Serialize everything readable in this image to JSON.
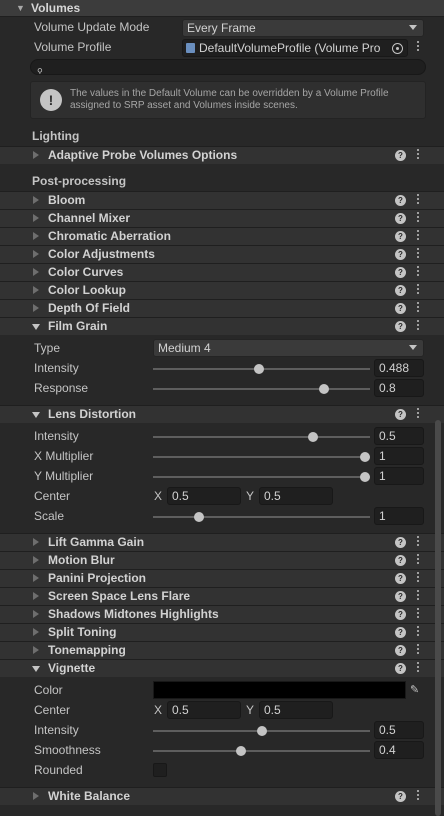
{
  "panel": {
    "title": "Volumes"
  },
  "volume": {
    "update_mode_label": "Volume Update Mode",
    "update_mode_value": "Every Frame",
    "profile_label": "Volume Profile",
    "profile_value": "DefaultVolumeProfile (Volume Pro",
    "search_placeholder": "",
    "info_text_1": "The values in the Default Volume can be overridden by a Volume Profile",
    "info_text_2": "assigned to SRP asset and Volumes inside scenes."
  },
  "sections": {
    "lighting": "Lighting",
    "post_processing": "Post-processing"
  },
  "overrides": {
    "adaptive_probe": "Adaptive Probe Volumes Options",
    "bloom": "Bloom",
    "channel_mixer": "Channel Mixer",
    "chromatic_aberration": "Chromatic Aberration",
    "color_adjustments": "Color Adjustments",
    "color_curves": "Color Curves",
    "color_lookup": "Color Lookup",
    "depth_of_field": "Depth Of Field",
    "film_grain": "Film Grain",
    "lens_distortion": "Lens Distortion",
    "lift_gamma_gain": "Lift Gamma Gain",
    "motion_blur": "Motion Blur",
    "panini_projection": "Panini Projection",
    "screen_space_lens_flare": "Screen Space Lens Flare",
    "shadows_midtones_highlights": "Shadows Midtones Highlights",
    "split_toning": "Split Toning",
    "tonemapping": "Tonemapping",
    "vignette": "Vignette",
    "white_balance": "White Balance"
  },
  "film_grain": {
    "type_label": "Type",
    "type_value": "Medium 4",
    "intensity_label": "Intensity",
    "intensity_value": "0.488",
    "intensity_frac": 0.488,
    "response_label": "Response",
    "response_value": "0.8",
    "response_frac": 0.8
  },
  "lens_distortion": {
    "intensity_label": "Intensity",
    "intensity_value": "0.5",
    "intensity_frac": 0.75,
    "xmul_label": "X Multiplier",
    "xmul_value": "1",
    "xmul_frac": 1.0,
    "ymul_label": "Y Multiplier",
    "ymul_value": "1",
    "ymul_frac": 1.0,
    "center_label": "Center",
    "center_x_label": "X",
    "center_x": "0.5",
    "center_y_label": "Y",
    "center_y": "0.5",
    "scale_label": "Scale",
    "scale_value": "1",
    "scale_frac": 0.2
  },
  "vignette": {
    "color_label": "Color",
    "color_value": "#000000",
    "center_label": "Center",
    "center_x_label": "X",
    "center_x": "0.5",
    "center_y_label": "Y",
    "center_y": "0.5",
    "intensity_label": "Intensity",
    "intensity_value": "0.5",
    "intensity_frac": 0.5,
    "smoothness_label": "Smoothness",
    "smoothness_value": "0.4",
    "smoothness_frac": 0.4,
    "rounded_label": "Rounded",
    "rounded_checked": false
  },
  "icons": {
    "help": "?",
    "menu": "kebab-menu",
    "info": "!"
  }
}
